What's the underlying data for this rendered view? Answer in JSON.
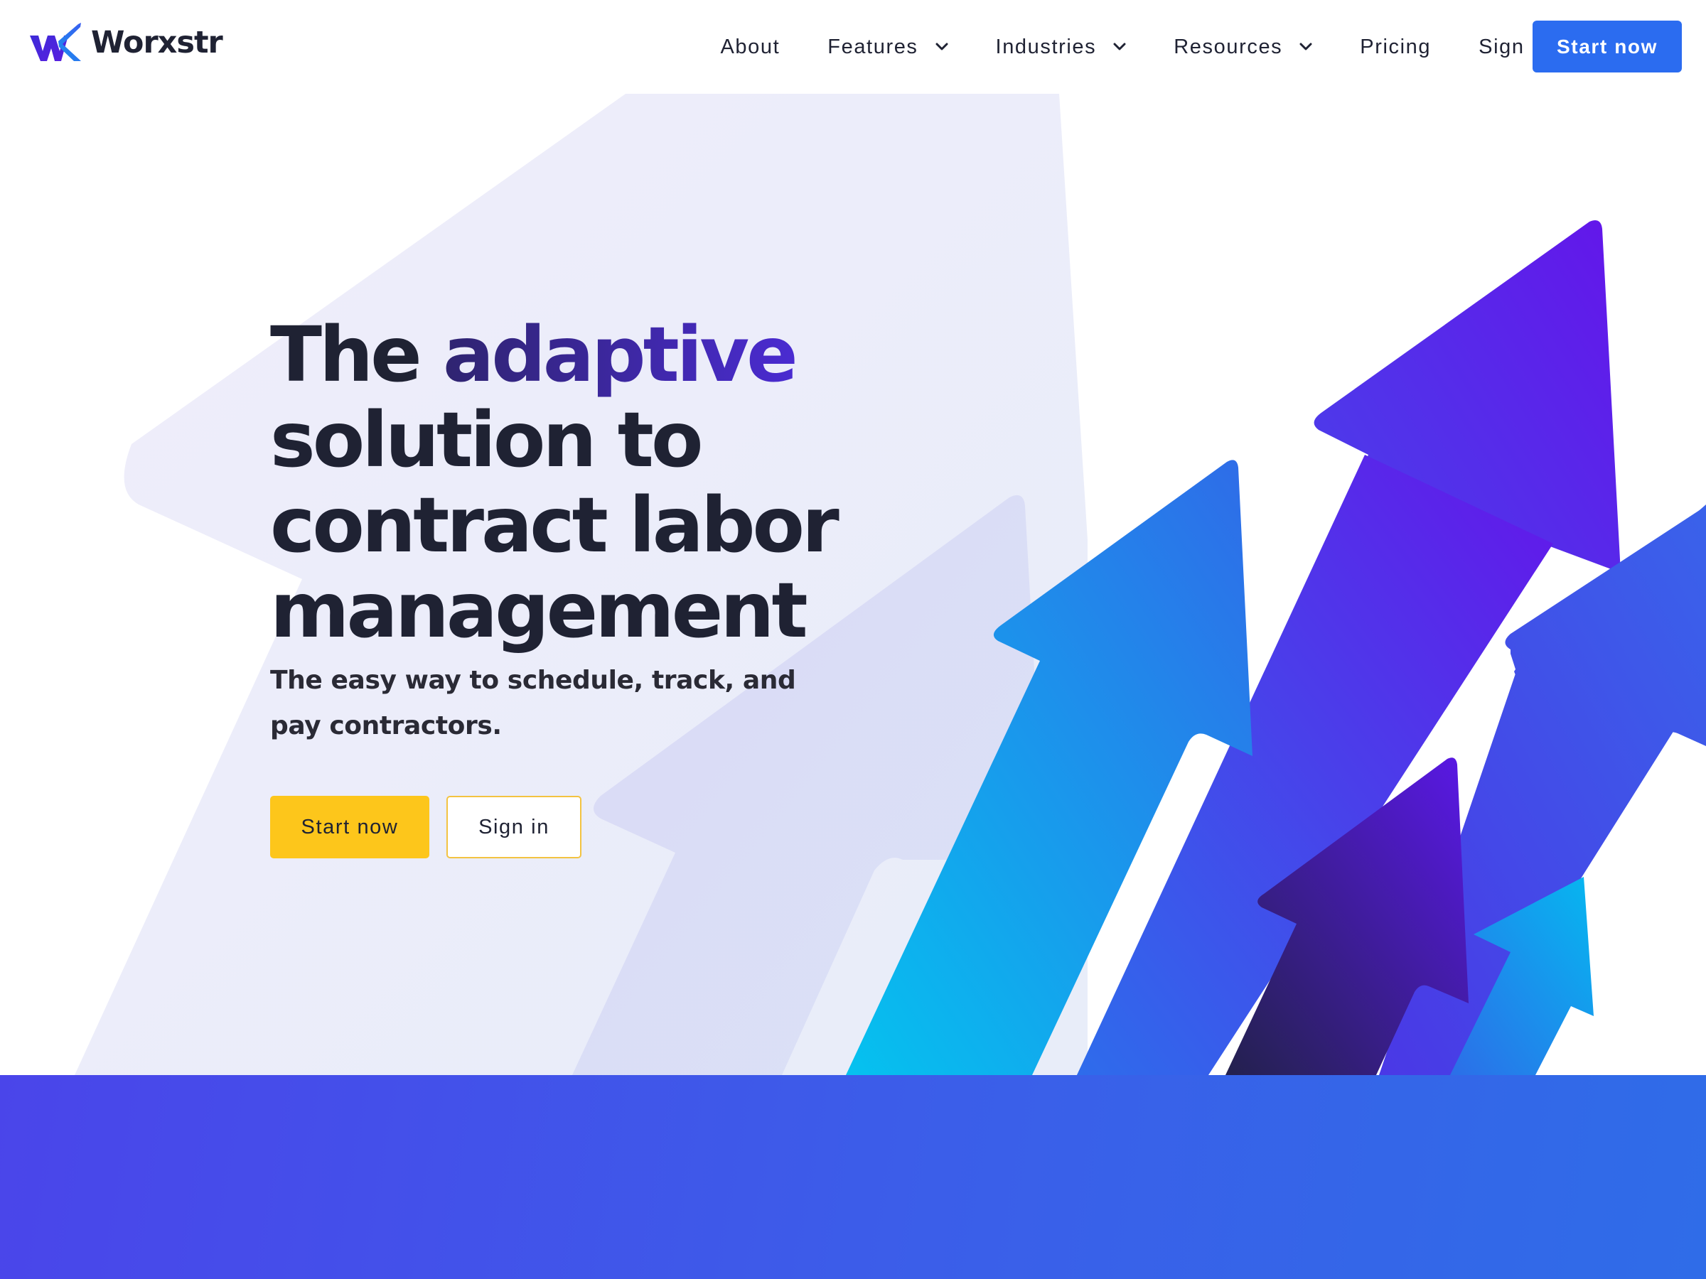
{
  "brand": {
    "name": "Worxstr",
    "logo_icon": "wx-logo-icon",
    "colors": {
      "dark": "#1f2233",
      "primary_blue": "#2b6cf0",
      "yellow": "#fdc61b",
      "purple": "#4a2bd1"
    }
  },
  "nav": {
    "items": [
      {
        "label": "About",
        "dropdown": false
      },
      {
        "label": "Features",
        "dropdown": true
      },
      {
        "label": "Industries",
        "dropdown": true
      },
      {
        "label": "Resources",
        "dropdown": true
      },
      {
        "label": "Pricing",
        "dropdown": false
      },
      {
        "label": "Sign in",
        "dropdown": false
      }
    ],
    "cta_label": "Start now"
  },
  "hero": {
    "title_before": "The",
    "title_accent": "adaptive",
    "title_after": "solution to contract labor management",
    "subtitle": "The easy way to schedule, track, and pay contractors.",
    "primary_button": "Start now",
    "secondary_button": "Sign in"
  }
}
